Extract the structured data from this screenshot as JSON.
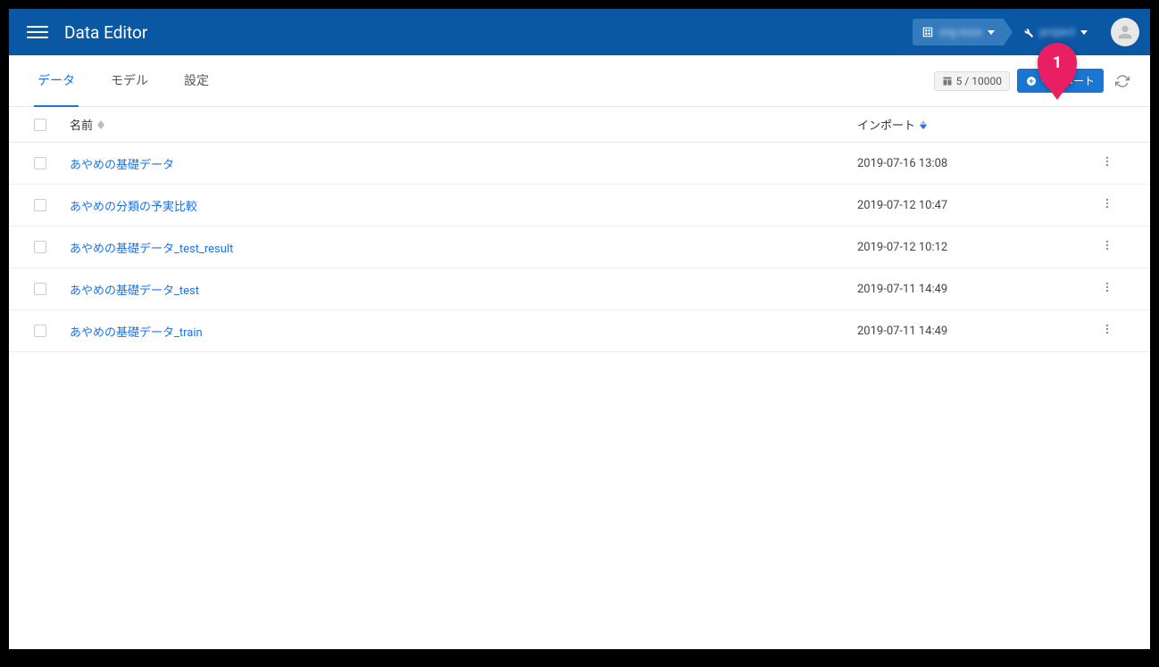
{
  "header": {
    "app_title": "Data Editor",
    "org_label": "org-xxxx",
    "project_label": "project"
  },
  "tabs": {
    "data": "データ",
    "model": "モデル",
    "settings": "設定"
  },
  "toolbar": {
    "count_label": "5 / 10000",
    "import_label": "インポート"
  },
  "columns": {
    "name": "名前",
    "import": "インポート"
  },
  "rows": [
    {
      "name": "あやめの基礎データ",
      "imported": "2019-07-16 13:08"
    },
    {
      "name": "あやめの分類の予実比較",
      "imported": "2019-07-12 10:47"
    },
    {
      "name": "あやめの基礎データ_test_result",
      "imported": "2019-07-12 10:12"
    },
    {
      "name": "あやめの基礎データ_test",
      "imported": "2019-07-11 14:49"
    },
    {
      "name": "あやめの基礎データ_train",
      "imported": "2019-07-11 14:49"
    }
  ],
  "annotation": {
    "pin1": "1"
  }
}
